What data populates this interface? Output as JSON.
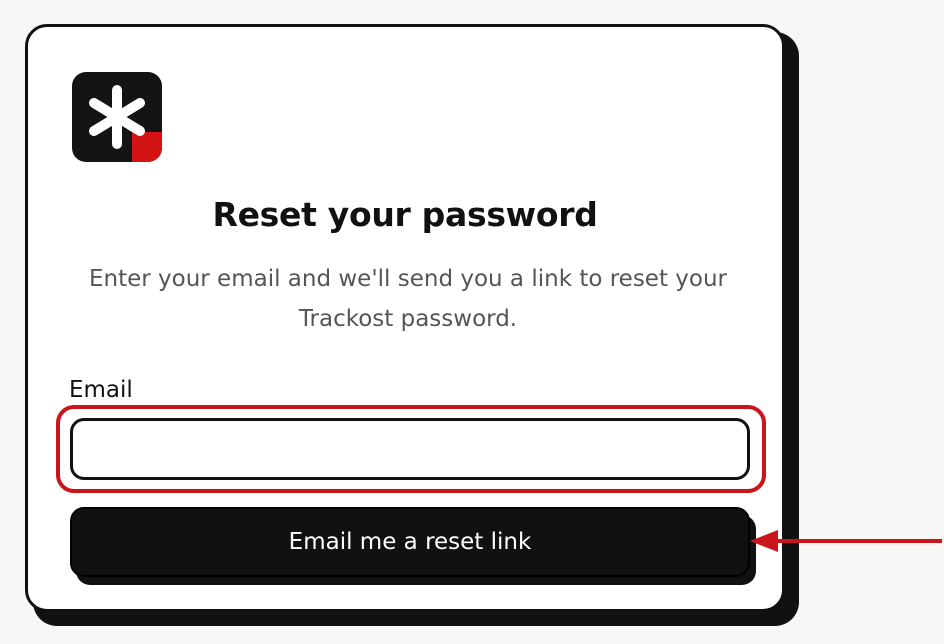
{
  "form": {
    "title": "Reset your password",
    "subtitle": "Enter your email and we'll send you a link to reset your Trackost password.",
    "email_label": "Email",
    "email_value": "",
    "submit_label": "Email me a reset link"
  },
  "colors": {
    "accent": "#d41414",
    "annotation": "#c8161b",
    "button": "#111111"
  },
  "icons": {
    "logo": "asterisk-logo-icon",
    "annotation": "arrow-left-icon"
  }
}
